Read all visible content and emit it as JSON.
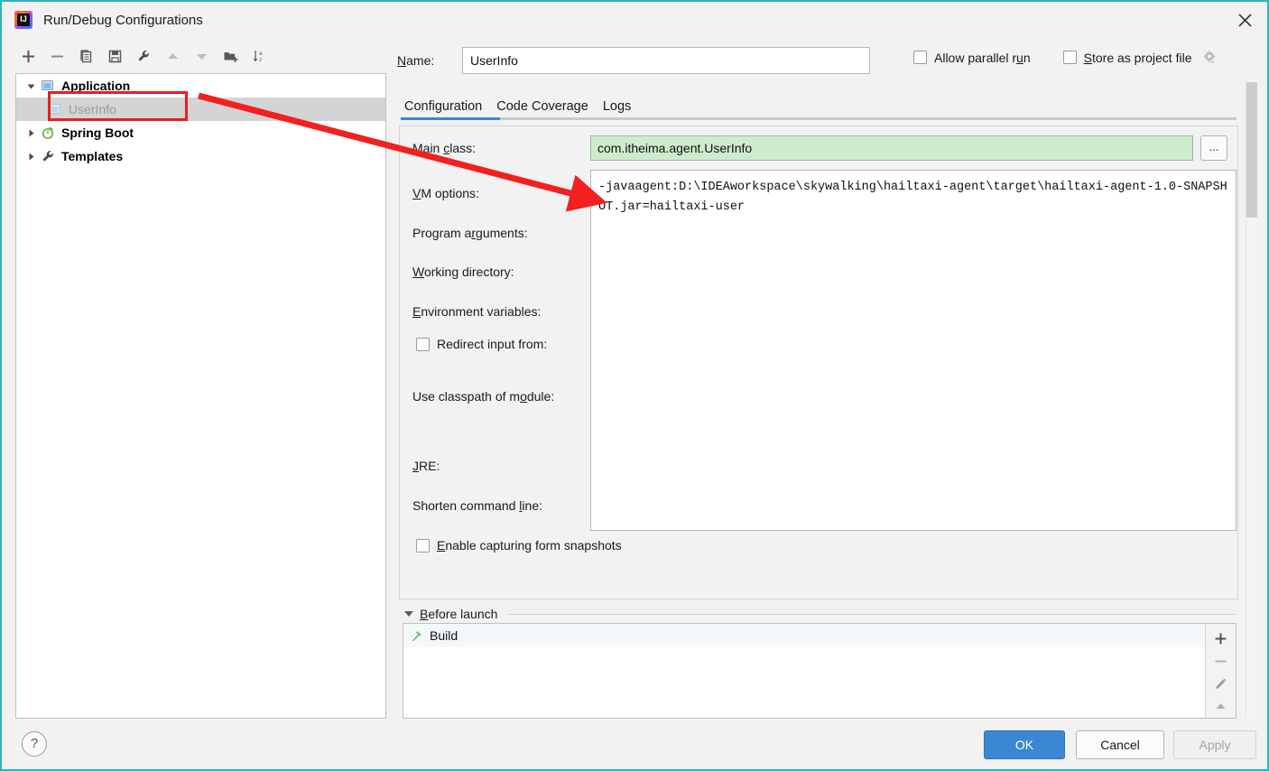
{
  "window": {
    "title": "Run/Debug Configurations",
    "app_icon": "intellij-idea-icon",
    "close_icon": "close-icon",
    "border_color": "#29b6bd"
  },
  "toolbar": {
    "buttons": [
      {
        "name": "add-configuration-button",
        "icon": "plus-icon",
        "label": "+"
      },
      {
        "name": "remove-configuration-button",
        "icon": "minus-icon",
        "label": "−"
      },
      {
        "name": "copy-configuration-button",
        "icon": "copy-icon",
        "label": "Copy"
      },
      {
        "name": "save-configuration-button",
        "icon": "save-icon",
        "label": "Save"
      },
      {
        "name": "edit-templates-button",
        "icon": "wrench-icon",
        "label": "Edit Templates"
      },
      {
        "name": "move-up-button",
        "icon": "arrow-up-icon",
        "label": "Move Up"
      },
      {
        "name": "move-down-button",
        "icon": "arrow-down-icon",
        "label": "Move Down"
      },
      {
        "name": "new-folder-button",
        "icon": "folder-add-icon",
        "label": "New Folder"
      },
      {
        "name": "sort-configurations-button",
        "icon": "sort-az-icon",
        "label": "Sort Configurations"
      }
    ]
  },
  "tree": {
    "nodes": [
      {
        "label": "Application",
        "icon": "application-icon",
        "expanded": true,
        "bold": true,
        "level": 0
      },
      {
        "label": "UserInfo",
        "icon": "application-icon",
        "selected": true,
        "bold": false,
        "level": 1
      },
      {
        "label": "Spring Boot",
        "icon": "spring-boot-icon",
        "expanded": false,
        "bold": true,
        "level": 0
      },
      {
        "label": "Templates",
        "icon": "wrench-icon",
        "expanded": false,
        "bold": true,
        "level": 0
      }
    ]
  },
  "name_field": {
    "label": "Name:",
    "value": "UserInfo",
    "placeholder": ""
  },
  "top_options": {
    "allow_parallel_run": {
      "label": "Allow parallel run",
      "checked": false
    },
    "store_as_project_file": {
      "label": "Store as project file",
      "checked": false
    },
    "gear_icon": "gear-icon"
  },
  "tabs": {
    "items": [
      {
        "label": "Configuration",
        "active": true
      },
      {
        "label": "Code Coverage",
        "active": false
      },
      {
        "label": "Logs",
        "active": false
      }
    ],
    "active_color": "#3b84d8"
  },
  "configuration": {
    "main_class": {
      "label": "Main class:",
      "value": "com.itheima.agent.UserInfo",
      "field_color": "#cdeccd",
      "browse_label": "..."
    },
    "vm_options": {
      "label": "VM options:",
      "value": "-javaagent:D:\\IDEAworkspace\\skywalking\\hailtaxi-agent\\target\\hailtaxi-agent-1.0-SNAPSHOT.jar=hailtaxi-user"
    },
    "program_arguments": {
      "label": "Program arguments:",
      "value": ""
    },
    "working_directory": {
      "label": "Working directory:",
      "value": ""
    },
    "environment_variables": {
      "label": "Environment variables:",
      "value": ""
    },
    "redirect_input_from": {
      "label": "Redirect input from:",
      "checked": false,
      "value": ""
    },
    "use_classpath_of_module": {
      "label": "Use classpath of module:",
      "value": ""
    },
    "jre": {
      "label": "JRE:",
      "value": ""
    },
    "shorten_command_line": {
      "label": "Shorten command line:",
      "value": ""
    },
    "enable_capturing_form_snapshots": {
      "label": "Enable capturing form snapshots",
      "checked": false
    }
  },
  "before_launch": {
    "title": "Before launch",
    "expanded": true,
    "rows": [
      {
        "label": "Build",
        "icon": "build-hammer-icon"
      }
    ],
    "tools": [
      {
        "name": "add-task-button",
        "icon": "plus-icon",
        "label": "+"
      },
      {
        "name": "remove-task-button",
        "icon": "minus-icon",
        "label": "−"
      },
      {
        "name": "edit-task-button",
        "icon": "pencil-icon",
        "label": "Edit"
      },
      {
        "name": "move-task-up-button",
        "icon": "arrow-up-icon",
        "label": "Up"
      }
    ]
  },
  "footer": {
    "help_label": "?",
    "ok_label": "OK",
    "cancel_label": "Cancel",
    "apply_label": "Apply",
    "apply_enabled": false
  },
  "annotations": {
    "highlight_color": "#ee1c1c",
    "arrow_color": "#f32020",
    "highlight_target": "UserInfo",
    "arrow_points_to": "VM options field"
  }
}
